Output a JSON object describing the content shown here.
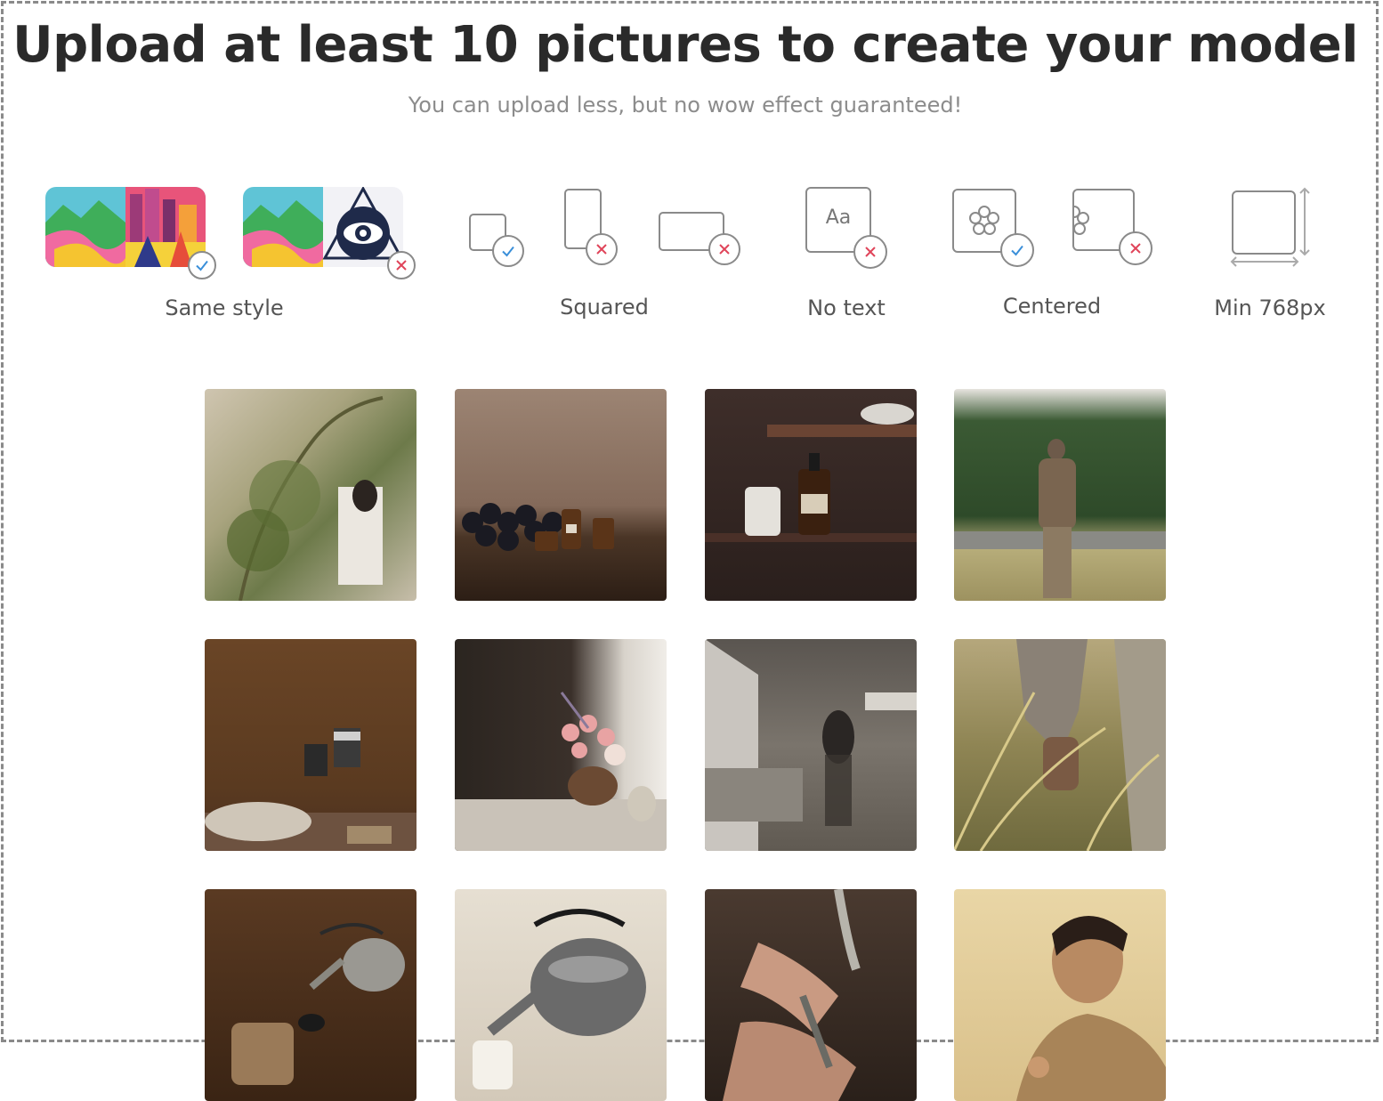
{
  "header": {
    "title": "Upload at least 10 pictures to create your model",
    "subtitle": "You can upload less, but no wow effect guaranteed!"
  },
  "rules": [
    {
      "label": "Same style"
    },
    {
      "label": "Squared"
    },
    {
      "label": "No text"
    },
    {
      "label": "Centered"
    },
    {
      "label": "Min 768px"
    }
  ],
  "rule_icons": {
    "no_text_sample": "Aa"
  },
  "colors": {
    "check": "#3a8fd9",
    "cross": "#e0445a",
    "outline": "#8a8a8a"
  },
  "photos": [
    {
      "name": "woman-with-plant"
    },
    {
      "name": "grapes-and-bottles"
    },
    {
      "name": "shelf-bottle-and-cup"
    },
    {
      "name": "man-in-garden"
    },
    {
      "name": "wall-with-photos"
    },
    {
      "name": "flowers-in-vase"
    },
    {
      "name": "store-interior"
    },
    {
      "name": "hand-in-grass"
    },
    {
      "name": "pouring-kettle"
    },
    {
      "name": "steel-kettle"
    },
    {
      "name": "hands-under-faucet"
    },
    {
      "name": "person-portrait"
    }
  ]
}
